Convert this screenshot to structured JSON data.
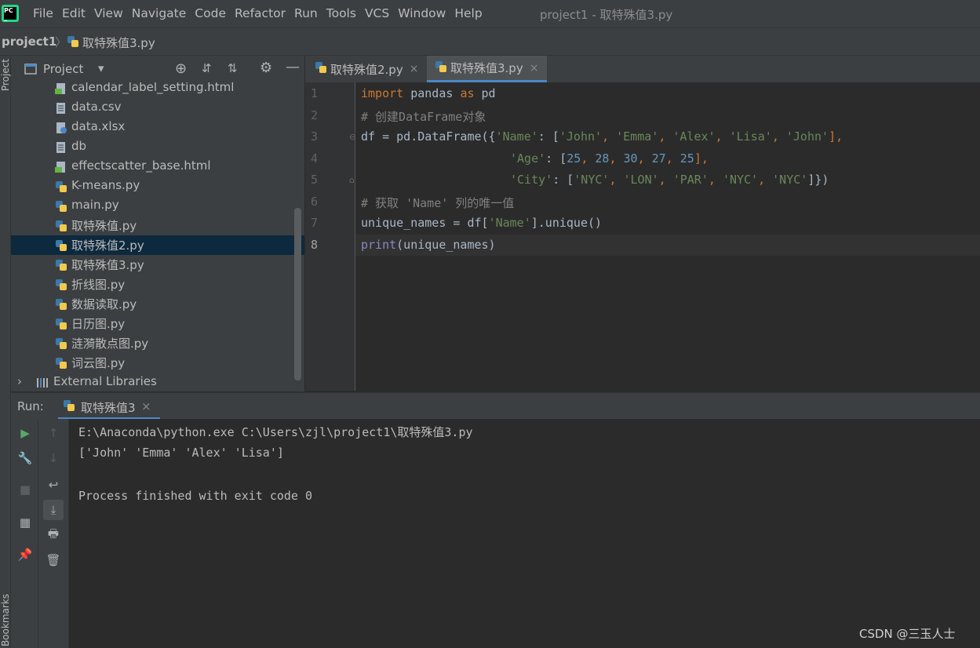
{
  "menu": {
    "items": [
      "File",
      "Edit",
      "View",
      "Navigate",
      "Code",
      "Refactor",
      "Run",
      "Tools",
      "VCS",
      "Window",
      "Help"
    ],
    "window_title": "project1 - 取特殊值3.py"
  },
  "breadcrumb": {
    "project": "project1",
    "file": "取特殊值3.py"
  },
  "left_strip": {
    "project_label": "Project",
    "bookmarks_label": "Bookmarks"
  },
  "project_panel": {
    "title": "Project",
    "files": [
      {
        "name": "calendar_label_setting.html",
        "icon": "html-file-icon"
      },
      {
        "name": "data.csv",
        "icon": "text-file-icon"
      },
      {
        "name": "data.xlsx",
        "icon": "unknown-file-icon"
      },
      {
        "name": "db",
        "icon": "text-file-icon"
      },
      {
        "name": "effectscatter_base.html",
        "icon": "html-file-icon"
      },
      {
        "name": "K-means.py",
        "icon": "python-file-icon"
      },
      {
        "name": "main.py",
        "icon": "python-file-icon"
      },
      {
        "name": "取特殊值.py",
        "icon": "python-file-icon"
      },
      {
        "name": "取特殊值2.py",
        "icon": "python-file-icon"
      },
      {
        "name": "取特殊值3.py",
        "icon": "python-file-icon"
      },
      {
        "name": "折线图.py",
        "icon": "python-file-icon"
      },
      {
        "name": "数据读取.py",
        "icon": "python-file-icon"
      },
      {
        "name": "日历图.py",
        "icon": "python-file-icon"
      },
      {
        "name": "涟漪散点图.py",
        "icon": "python-file-icon"
      },
      {
        "name": "词云图.py",
        "icon": "python-file-icon"
      }
    ],
    "selected": "取特殊值2.py",
    "external_libraries": "External Libraries"
  },
  "editor": {
    "tabs": [
      "取特殊值2.py",
      "取特殊值3.py"
    ],
    "active_tab": "取特殊值3.py",
    "line_numbers": [
      "1",
      "2",
      "3",
      "4",
      "5",
      "6",
      "7",
      "8"
    ],
    "current_line": 8,
    "code": {
      "l1_kw1": "import",
      "l1_t1": " pandas ",
      "l1_kw2": "as",
      "l1_t2": " pd",
      "l2": "# 创建DataFrame对象",
      "l3_t1": "df = pd.DataFrame({",
      "l3_s1": "'Name'",
      "l3_t2": ": [",
      "l3_s2": "'John'",
      "l3_c1": ", ",
      "l3_s3": "'Emma'",
      "l3_c2": ", ",
      "l3_s4": "'Alex'",
      "l3_c3": ", ",
      "l3_s5": "'Lisa'",
      "l3_c4": ", ",
      "l3_s6": "'John'",
      "l3_t3": "],",
      "l4_s1": "'Age'",
      "l4_t1": ": [",
      "l4_n1": "25",
      "l4_c1": ", ",
      "l4_n2": "28",
      "l4_c2": ", ",
      "l4_n3": "30",
      "l4_c3": ", ",
      "l4_n4": "27",
      "l4_c4": ", ",
      "l4_n5": "25",
      "l4_t2": "],",
      "l5_s1": "'City'",
      "l5_t1": ": [",
      "l5_s2": "'NYC'",
      "l5_c1": ", ",
      "l5_s3": "'LON'",
      "l5_c2": ", ",
      "l5_s4": "'PAR'",
      "l5_c3": ", ",
      "l5_s5": "'NYC'",
      "l5_c4": ", ",
      "l5_s6": "'NYC'",
      "l5_t2": "]})",
      "l6": "# 获取 'Name' 列的唯一值",
      "l7_t1": "unique_names = df[",
      "l7_s1": "'Name'",
      "l7_t2": "].unique()",
      "l8_b1": "print",
      "l8_t1": "(unique_names)"
    }
  },
  "run_panel": {
    "label": "Run:",
    "tab": "取特殊值3",
    "output": [
      "E:\\Anaconda\\python.exe C:\\Users\\zjl\\project1\\取特殊值3.py",
      "['John' 'Emma' 'Alex' 'Lisa']",
      "",
      "Process finished with exit code 0"
    ]
  },
  "watermark": "CSDN @三玉人士",
  "colors": {
    "background": "#2b2b2b",
    "panel": "#3c3f41",
    "keyword": "#cc7832",
    "string": "#6a8759",
    "number": "#6897bb",
    "comment": "#808080",
    "selection": "#0d293e",
    "accent": "#4a88c7"
  }
}
